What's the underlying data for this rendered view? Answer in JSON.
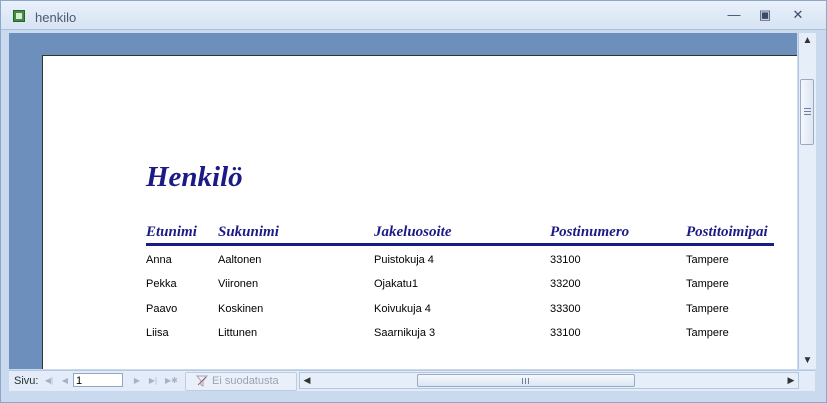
{
  "window": {
    "title": "henkilo"
  },
  "report": {
    "title": "Henkilö",
    "columns": [
      "Etunimi",
      "Sukunimi",
      "Jakeluosoite",
      "Postinumero",
      "Postitoimipai"
    ],
    "rows": [
      [
        "Anna",
        "Aaltonen",
        "Puistokuja 4",
        "33100",
        "Tampere"
      ],
      [
        "Pekka",
        "Viironen",
        "Ojakatu1",
        "33200",
        "Tampere"
      ],
      [
        "Paavo",
        "Koskinen",
        "Koivukuja 4",
        "33300",
        "Tampere"
      ],
      [
        "Liisa",
        "Littunen",
        "Saarnikuja 3",
        "33100",
        "Tampere"
      ]
    ]
  },
  "navigation": {
    "page_label": "Sivu:",
    "page_value": "1",
    "filter_label": "Ei suodatusta"
  },
  "icons": [
    "app-icon",
    "minimize-icon",
    "maximize-icon",
    "close-icon",
    "first-page-icon",
    "prev-page-icon",
    "next-page-icon",
    "last-page-icon",
    "new-record-icon",
    "filter-icon"
  ]
}
